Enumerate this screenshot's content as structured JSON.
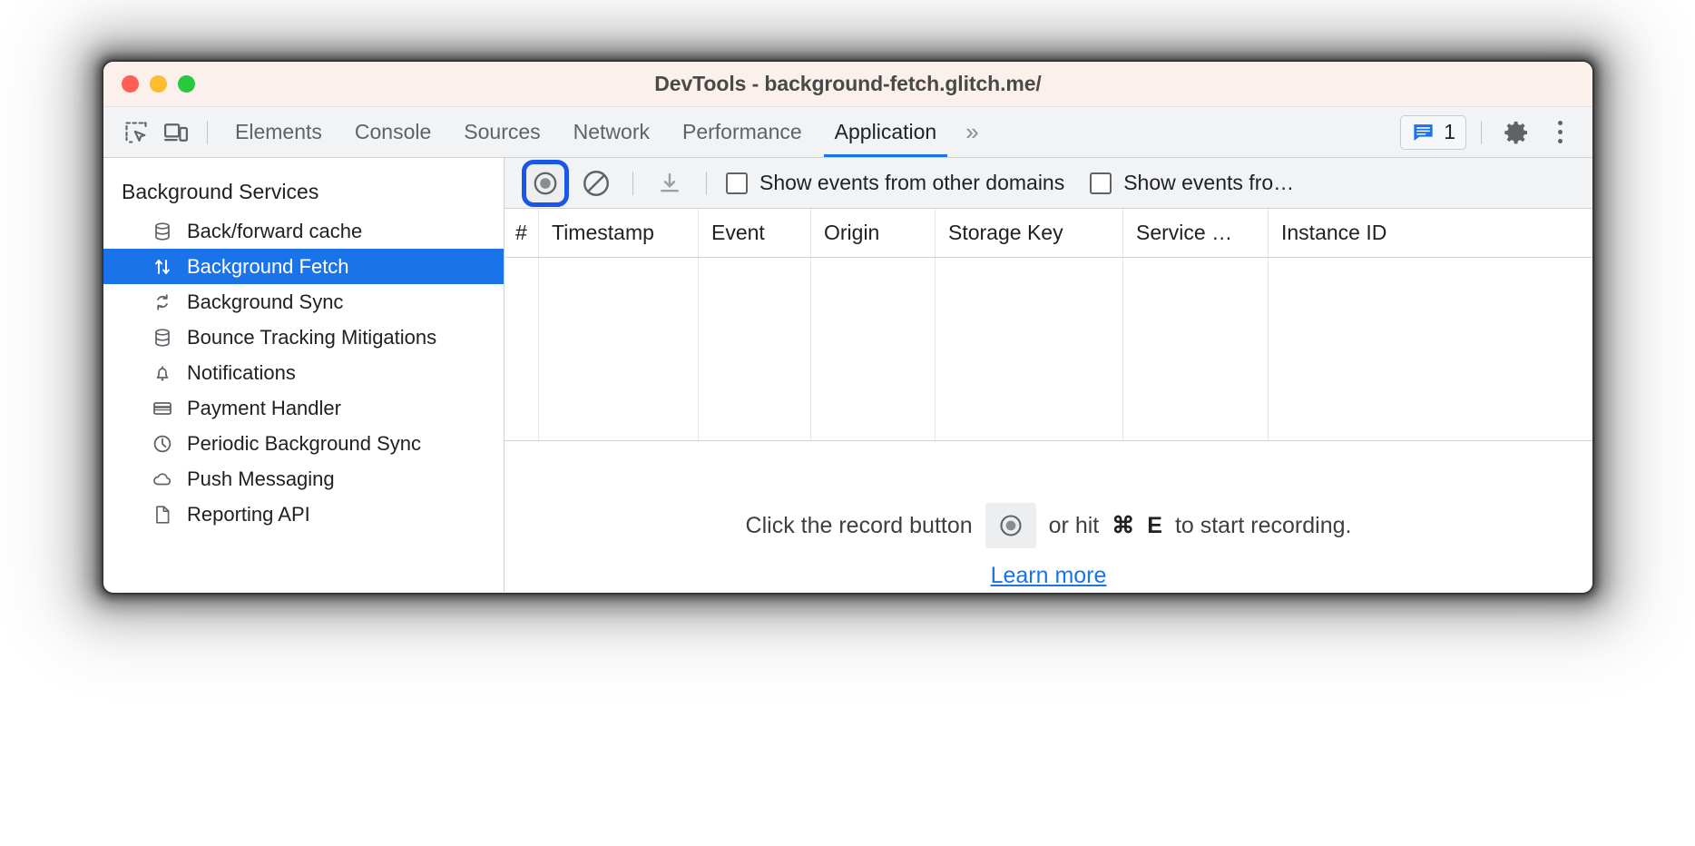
{
  "window": {
    "title": "DevTools - background-fetch.glitch.me/",
    "traffic_lights": [
      "close",
      "minimize",
      "maximize"
    ]
  },
  "devtools_tabbar": {
    "inspect_icon": "inspect-element-icon",
    "device_icon": "device-toolbar-icon",
    "tabs": [
      {
        "label": "Elements",
        "active": false
      },
      {
        "label": "Console",
        "active": false
      },
      {
        "label": "Sources",
        "active": false
      },
      {
        "label": "Network",
        "active": false
      },
      {
        "label": "Performance",
        "active": false
      },
      {
        "label": "Application",
        "active": true
      }
    ],
    "more_tabs_label": "»",
    "issues_count": "1",
    "issues_icon": "issues-message-icon",
    "settings_icon": "gear-icon",
    "menu_icon": "kebab-menu-icon"
  },
  "sidebar": {
    "section_title": "Background Services",
    "items": [
      {
        "label": "Back/forward cache",
        "icon": "database-icon",
        "selected": false
      },
      {
        "label": "Background Fetch",
        "icon": "arrows-up-down-icon",
        "selected": true
      },
      {
        "label": "Background Sync",
        "icon": "sync-refresh-icon",
        "selected": false
      },
      {
        "label": "Bounce Tracking Mitigations",
        "icon": "database-icon",
        "selected": false
      },
      {
        "label": "Notifications",
        "icon": "bell-icon",
        "selected": false
      },
      {
        "label": "Payment Handler",
        "icon": "credit-card-icon",
        "selected": false
      },
      {
        "label": "Periodic Background Sync",
        "icon": "clock-icon",
        "selected": false
      },
      {
        "label": "Push Messaging",
        "icon": "cloud-icon",
        "selected": false
      },
      {
        "label": "Reporting API",
        "icon": "document-icon",
        "selected": false
      }
    ]
  },
  "panel": {
    "toolbar": {
      "record_icon": "record-circle-icon",
      "record_highlighted": true,
      "clear_icon": "clear-no-entry-icon",
      "export_icon": "download-save-icon",
      "checkboxes": [
        {
          "label": "Show events from other domains",
          "checked": false
        },
        {
          "label": "Show events fro…",
          "checked": false
        }
      ]
    },
    "table": {
      "columns": [
        "#",
        "Timestamp",
        "Event",
        "Origin",
        "Storage Key",
        "Service …",
        "Instance ID"
      ],
      "rows": []
    },
    "empty_state": {
      "text_before": "Click the record button",
      "record_icon": "record-circle-icon",
      "text_after_1": "or hit",
      "shortcut_modifier": "⌘",
      "shortcut_key": "E",
      "text_after_2": "to start recording.",
      "link_label": "Learn more"
    }
  },
  "colors": {
    "accent_blue": "#1a73e8",
    "highlight_ring": "#1a56e8",
    "titlebar_bg": "#fbf0eb",
    "toolbar_bg": "#f1f3f4"
  }
}
